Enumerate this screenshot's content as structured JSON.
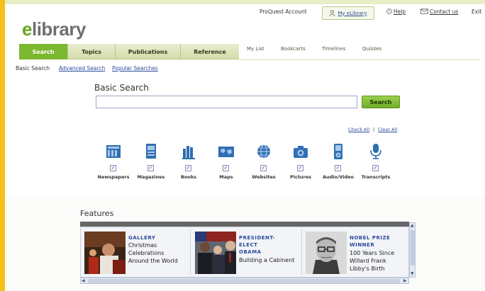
{
  "brand": {
    "logo_prefix": "e",
    "logo_rest": "library"
  },
  "header_links": {
    "account": "ProQuest Account",
    "my_elibrary": "My eLibrary",
    "help": "Help",
    "contact": "Contact us",
    "exit": "Exit"
  },
  "nav": {
    "tabs": [
      "Search",
      "Topics",
      "Publications",
      "Reference"
    ],
    "active": "Search"
  },
  "secondary_nav": [
    "My List",
    "Bookcarts",
    "Timelines",
    "Quizzes"
  ],
  "subnav": [
    "Basic Search",
    "Advanced Search",
    "Popular Searches"
  ],
  "search": {
    "title": "Basic Search",
    "value": "",
    "button": "Search",
    "check_all": "Check All",
    "separator": "|",
    "clear_all": "Clear All"
  },
  "sources": [
    {
      "label": "Newspapers",
      "icon": "newspaper-icon",
      "checked": true
    },
    {
      "label": "Magazines",
      "icon": "magazine-icon",
      "checked": true
    },
    {
      "label": "Books",
      "icon": "books-icon",
      "checked": true
    },
    {
      "label": "Maps",
      "icon": "map-icon",
      "checked": true
    },
    {
      "label": "Websites",
      "icon": "globe-icon",
      "checked": true
    },
    {
      "label": "Pictures",
      "icon": "camera-icon",
      "checked": true
    },
    {
      "label": "Audio/Video",
      "icon": "media-player-icon",
      "checked": true
    },
    {
      "label": "Transcripts",
      "icon": "microphone-icon",
      "checked": true
    }
  ],
  "features": {
    "title": "Features",
    "items": [
      {
        "label": "GALLERY",
        "text": [
          "Christmas",
          "Celebrations",
          "Around the World"
        ]
      },
      {
        "label": [
          "PRESIDENT-",
          "ELECT",
          "OBAMA"
        ],
        "text": [
          "Building a Cabinent"
        ]
      },
      {
        "label": [
          "NOBEL PRIZE",
          "WINNER"
        ],
        "text": [
          "100 Years Since",
          "Willard Frank",
          "Libby's Birth"
        ]
      }
    ]
  },
  "colors": {
    "accent_green": "#7cb82f",
    "link_blue": "#2c4a9a",
    "left_bar": "#f2c21b"
  }
}
